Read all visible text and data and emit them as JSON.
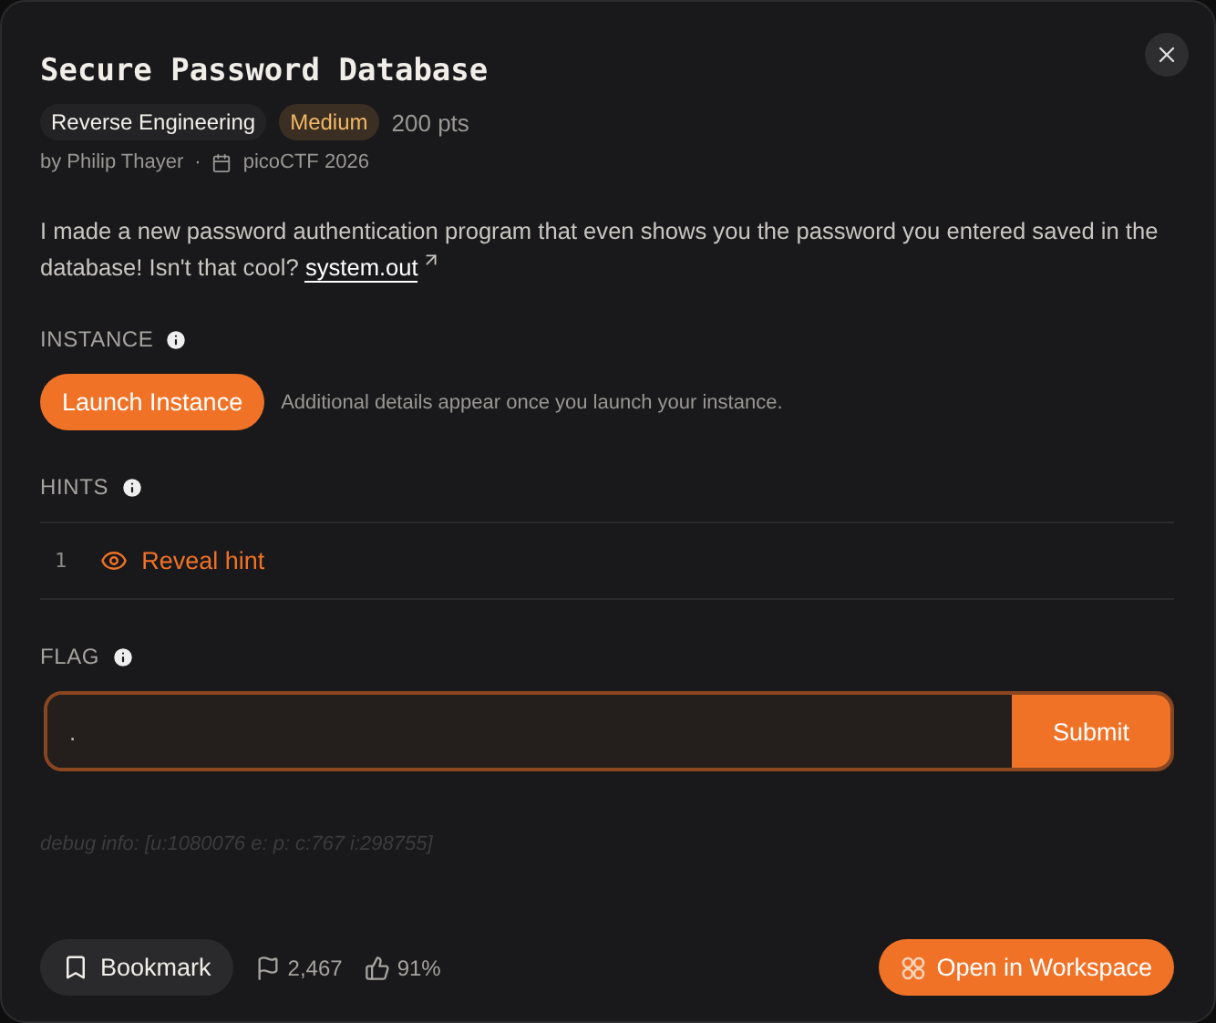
{
  "dialog": {
    "title": "Secure Password Database"
  },
  "tags": [
    {
      "label": "Reverse Engineering",
      "kind": "category"
    },
    {
      "label": "Medium",
      "kind": "difficulty"
    }
  ],
  "points": "200 pts",
  "author": "by Philip Thayer",
  "separator": "·",
  "event": "picoCTF 2026",
  "description": "I made a new password authentication program that even shows you the password you entered saved in the database! Isn't that cool?",
  "attachment": "system.out",
  "instance": {
    "heading": "INSTANCE",
    "button": "Launch Instance",
    "note": "Additional details appear once you launch your instance."
  },
  "hints": {
    "heading": "HINTS",
    "items": [
      {
        "number": "1",
        "label": "Reveal hint"
      }
    ]
  },
  "flag": {
    "heading": "FLAG",
    "value": ".",
    "submit": "Submit"
  },
  "debug": "debug info: [u:1080076 e: p: c:767 i:298755]",
  "footer": {
    "bookmark": "Bookmark",
    "solves": "2,467",
    "likes": "91%",
    "workspace": "Open in Workspace"
  }
}
